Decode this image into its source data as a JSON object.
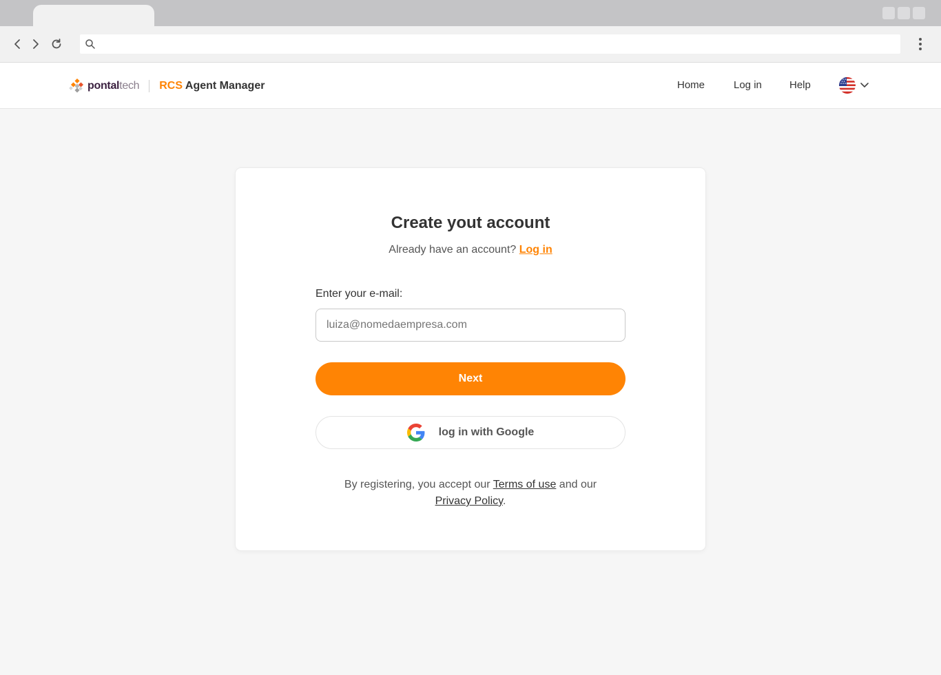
{
  "browser": {
    "address": ""
  },
  "header": {
    "logo_part1": "pontal",
    "logo_part2": "tech",
    "product_accent": "RCS",
    "product_name": " Agent Manager",
    "nav": [
      {
        "label": "Home"
      },
      {
        "label": "Log in"
      },
      {
        "label": "Help"
      }
    ],
    "language": "us-flag-icon"
  },
  "signup": {
    "title": "Create yout account",
    "already_text": "Already have an account?",
    "login_link": "Log in",
    "email_label": "Enter your e-mail:",
    "email_placeholder": "luiza@nomedaempresa.com",
    "email_value": "",
    "next_label": "Next",
    "google_label": "log in with Google",
    "legal_prefix": "By registering, you accept our",
    "terms_link": "Terms of use",
    "legal_middle": "and our",
    "privacy_link": "Privacy Policy",
    "legal_suffix": "."
  },
  "colors": {
    "accent": "#ff8404",
    "background": "#f6f6f6",
    "logo_dark": "#3a1f3f"
  }
}
